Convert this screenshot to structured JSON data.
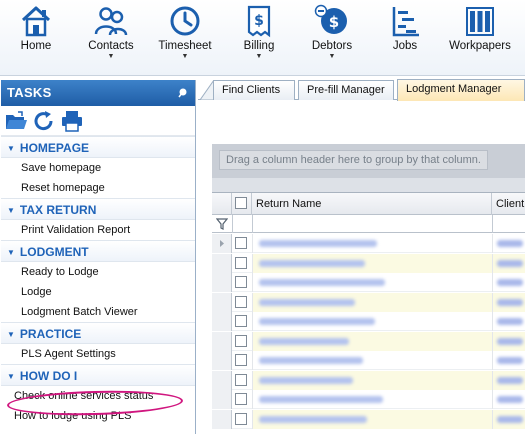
{
  "ribbon": {
    "buttons": [
      {
        "label": "Home",
        "icon": "home-icon",
        "has_menu": false
      },
      {
        "label": "Contacts",
        "icon": "contacts-icon",
        "has_menu": true
      },
      {
        "label": "Timesheet",
        "icon": "clock-icon",
        "has_menu": true
      },
      {
        "label": "Billing",
        "icon": "invoice-icon",
        "has_menu": true
      },
      {
        "label": "Debtors",
        "icon": "debtors-icon",
        "has_menu": true
      },
      {
        "label": "Jobs",
        "icon": "jobs-icon",
        "has_menu": false
      },
      {
        "label": "Workpapers",
        "icon": "workpapers-icon",
        "has_menu": false
      }
    ],
    "menu_arrow": "▼"
  },
  "tasks": {
    "title": "TASKS",
    "tools": [
      "open-folder-icon",
      "refresh-icon",
      "print-icon"
    ],
    "sections": [
      {
        "title": "HOMEPAGE",
        "items": [
          "Save homepage",
          "Reset homepage"
        ]
      },
      {
        "title": "TAX RETURN",
        "items": [
          "Print Validation Report"
        ]
      },
      {
        "title": "LODGMENT",
        "items": [
          "Ready to Lodge",
          "Lodge",
          "Lodgment Batch Viewer"
        ]
      },
      {
        "title": "PRACTICE",
        "items": [
          "PLS Agent Settings"
        ]
      },
      {
        "title": "HOW DO I",
        "items": [
          "Check online services status",
          "How to lodge using PLS"
        ]
      }
    ],
    "section_arrow": "▼",
    "highlighted_item": "Check online services status",
    "highlight_color": "#d0167f"
  },
  "tabs": [
    {
      "label": "Find Clients",
      "active": false
    },
    {
      "label": "Pre-fill Manager",
      "active": false
    },
    {
      "label": "Lodgment Manager",
      "active": true
    }
  ],
  "grid": {
    "group_hint": "Drag a column header here to group by that column.",
    "columns": [
      "Return Name",
      "Client"
    ],
    "row_count": 10
  },
  "colors": {
    "accent": "#1f63b8",
    "tasks_header": "#2a6db5",
    "active_tab": "#fde7b5",
    "alt_row": "#fbfae2"
  }
}
